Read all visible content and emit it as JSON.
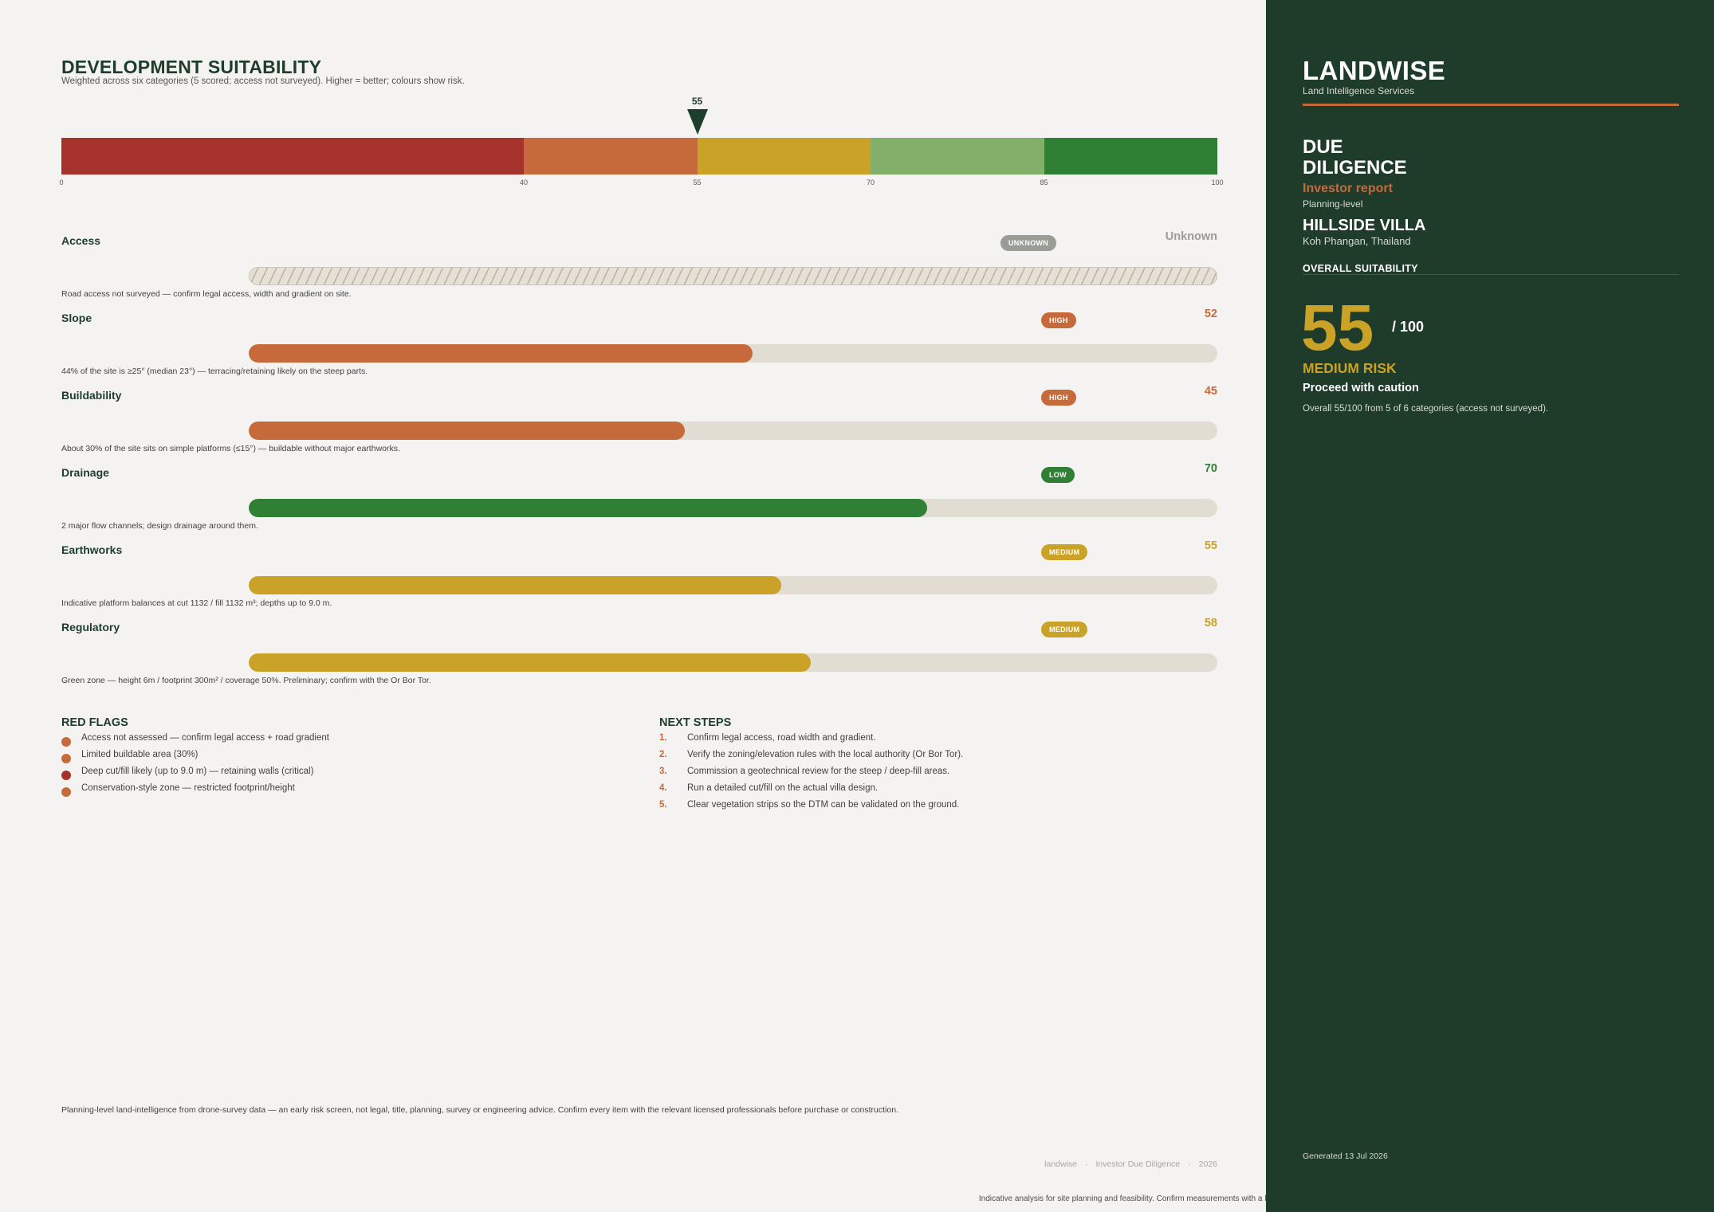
{
  "header": {
    "title": "DEVELOPMENT SUITABILITY",
    "subtitle": "Weighted across six categories (5 scored; access not surveyed). Higher = better; colours show risk."
  },
  "scale": {
    "marker_value": "55",
    "marker_score": 55,
    "min": 0,
    "max": 100,
    "ticks": [
      "0",
      "40",
      "55",
      "70",
      "85",
      "100"
    ],
    "bands": [
      {
        "from": 0,
        "to": 40,
        "color": "#a5332b"
      },
      {
        "from": 40,
        "to": 55,
        "color": "#c66a3c"
      },
      {
        "from": 55,
        "to": 70,
        "color": "#c9a227"
      },
      {
        "from": 70,
        "to": 85,
        "color": "#82b06a"
      },
      {
        "from": 85,
        "to": 100,
        "color": "#2f7f35"
      }
    ]
  },
  "categories": [
    {
      "name": "Access",
      "risk": "UNKNOWN",
      "score_text": "Unknown",
      "score": null,
      "color": "#9a9c96",
      "note": "Road access not surveyed — confirm legal access, width and gradient on site."
    },
    {
      "name": "Slope",
      "risk": "HIGH",
      "score_text": "52",
      "score": 52,
      "color": "#c66a3c",
      "note": "44% of the site is ≥25° (median 23°) — terracing/retaining likely on the steep parts."
    },
    {
      "name": "Buildability",
      "risk": "HIGH",
      "score_text": "45",
      "score": 45,
      "color": "#c66a3c",
      "note": "About 30% of the site sits on simple platforms (≤15°) — buildable without major earthworks."
    },
    {
      "name": "Drainage",
      "risk": "LOW",
      "score_text": "70",
      "score": 70,
      "color": "#2f7f35",
      "note": "2 major flow channels; design drainage around them."
    },
    {
      "name": "Earthworks",
      "risk": "MEDIUM",
      "score_text": "55",
      "score": 55,
      "color": "#c9a227",
      "note": "Indicative platform balances at cut 1132 / fill 1132 m³; depths up to 9.0 m."
    },
    {
      "name": "Regulatory",
      "risk": "MEDIUM",
      "score_text": "58",
      "score": 58,
      "color": "#c9a227",
      "note": "Green zone — height 6m / footprint 300m² / coverage 50%. Preliminary; confirm with the Or Bor Tor."
    }
  ],
  "red_flags": {
    "title": "RED FLAGS",
    "items": [
      {
        "text": "Access not assessed — confirm legal access + road gradient",
        "color": "#c66a3c"
      },
      {
        "text": "Limited buildable area (30%)",
        "color": "#c66a3c"
      },
      {
        "text": "Deep cut/fill likely (up to 9.0 m) — retaining walls (critical)",
        "color": "#a5332b"
      },
      {
        "text": "Conservation-style zone — restricted footprint/height",
        "color": "#c66a3c"
      }
    ]
  },
  "next_steps": {
    "title": "NEXT STEPS",
    "items": [
      {
        "num": "1.",
        "text": "Confirm legal access, road width and gradient."
      },
      {
        "num": "2.",
        "text": "Verify the zoning/elevation rules with the local authority (Or Bor Tor)."
      },
      {
        "num": "3.",
        "text": "Commission a geotechnical review for the steep / deep-fill areas."
      },
      {
        "num": "4.",
        "text": "Run a detailed cut/fill on the actual villa design."
      },
      {
        "num": "5.",
        "text": "Clear vegetation strips so the DTM can be validated on the ground."
      }
    ]
  },
  "footer": {
    "disclaimer": "Planning-level land-intelligence from drone-survey data — an early risk screen, not legal, title, planning, survey or engineering advice. Confirm every item with the relevant licensed professionals before purchase or construction.",
    "meta_brand": "landwise",
    "meta_doc": "Investor Due Diligence",
    "meta_year": "2026",
    "meta_sep": "·",
    "legal": "Indicative analysis for site planning and feasibility. Confirm measurements with a licensed cadastral survey before any legal, valuation or construction decision. © LandWise Intelligence Company Limited"
  },
  "sidebar": {
    "brand": "LANDWISE",
    "brand_sub": "Land Intelligence Services",
    "doc_title_line1": "DUE",
    "doc_title_line2": "DILIGENCE",
    "doc_type": "Investor report",
    "doc_level": "Planning-level",
    "site_name": "HILLSIDE VILLA",
    "site_location": "Koh Phangan, Thailand",
    "overall_label": "OVERALL SUITABILITY",
    "score": "55",
    "score_max": "/ 100",
    "risk_level": "MEDIUM RISK",
    "risk_action": "Proceed with caution",
    "risk_detail": "Overall 55/100 from 5 of 6 categories (access not surveyed).",
    "generated": "Generated 13 Jul 2026"
  }
}
